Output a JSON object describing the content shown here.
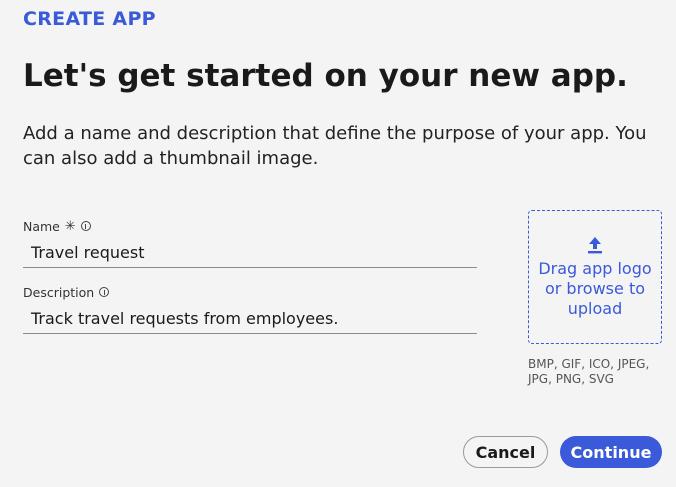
{
  "header": {
    "eyebrow": "CREATE APP",
    "title": "Let's get started on your new app.",
    "subtitle": "Add a name and description that define the purpose of your app. You can also add a thumbnail image."
  },
  "form": {
    "name": {
      "label": "Name",
      "required_mark": "✳",
      "value": "Travel request"
    },
    "description": {
      "label": "Description",
      "value": "Track travel requests from employees."
    }
  },
  "upload": {
    "label": "Drag app logo or browse to upload",
    "formats": "BMP, GIF, ICO, JPEG, JPG, PNG, SVG",
    "icon": "upload-icon"
  },
  "actions": {
    "cancel_label": "Cancel",
    "continue_label": "Continue"
  },
  "colors": {
    "accent": "#3a5ad9",
    "background": "#f4f4f4"
  }
}
